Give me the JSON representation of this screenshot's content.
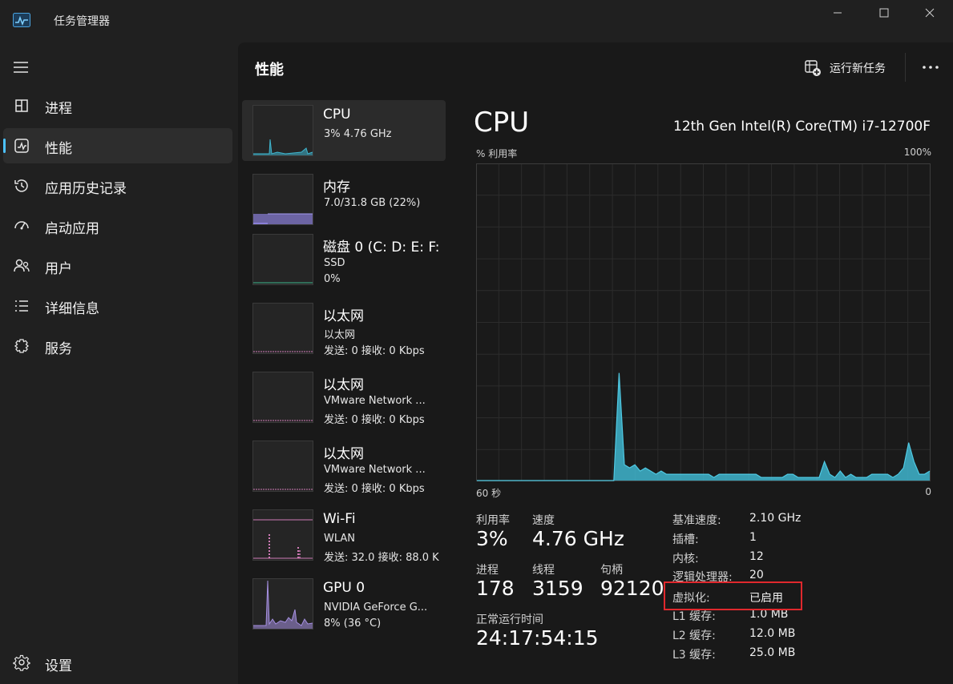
{
  "window": {
    "title": "任务管理器",
    "app_icon": "task-manager-icon",
    "controls": [
      "minimize-icon",
      "maximize-icon",
      "close-icon"
    ]
  },
  "sidebar": {
    "menu_icon": "hamburger-icon",
    "items": [
      {
        "label": "进程",
        "icon": "processes-icon"
      },
      {
        "label": "性能",
        "icon": "performance-icon",
        "active": true
      },
      {
        "label": "应用历史记录",
        "icon": "history-icon"
      },
      {
        "label": "启动应用",
        "icon": "startup-icon"
      },
      {
        "label": "用户",
        "icon": "users-icon"
      },
      {
        "label": "详细信息",
        "icon": "details-icon"
      },
      {
        "label": "服务",
        "icon": "services-icon"
      }
    ],
    "settings": {
      "label": "设置",
      "icon": "gear-icon"
    }
  },
  "header": {
    "title": "性能",
    "run_task_label": "运行新任务",
    "more_icon": "more-icon"
  },
  "devices": [
    {
      "name": "CPU",
      "line1": "3% 4.76 GHz",
      "line2": "",
      "color": "#3fb6cf",
      "active": true
    },
    {
      "name": "内存",
      "line1": "7.0/31.8 GB (22%)",
      "line2": "",
      "color": "#8a7fd8"
    },
    {
      "name": "磁盘 0 (C: D: E: F:",
      "line1": "SSD",
      "line2": "0%",
      "color": "#3bb58b"
    },
    {
      "name": "以太网",
      "line1": "以太网",
      "line2": "发送: 0 接收: 0 Kbps",
      "color": "#d07bb7"
    },
    {
      "name": "以太网",
      "line1": "VMware Network ...",
      "line2": "发送: 0 接收: 0 Kbps",
      "color": "#d07bb7"
    },
    {
      "name": "以太网",
      "line1": "VMware Network ...",
      "line2": "发送: 0 接收: 0 Kbps",
      "color": "#d07bb7"
    },
    {
      "name": "Wi-Fi",
      "line1": "WLAN",
      "line2": "发送: 32.0 接收: 88.0 K",
      "color": "#d07bb7"
    },
    {
      "name": "GPU 0",
      "line1": "NVIDIA GeForce G...",
      "line2": "8% (36 °C)",
      "color": "#a58fe0"
    }
  ],
  "cpu": {
    "title": "CPU",
    "model": "12th Gen Intel(R) Core(TM) i7-12700F",
    "graph_label_top_left": "% 利用率",
    "graph_label_top_right": "100%",
    "graph_label_bottom_left": "60 秒",
    "graph_label_bottom_right": "0",
    "graph_color": "#3fb6cf",
    "utilization_history": [
      0,
      0,
      0,
      0,
      0,
      0,
      0,
      0,
      0,
      0,
      0,
      0,
      0,
      0,
      0,
      0,
      0,
      0,
      0,
      0,
      0,
      0,
      0,
      0,
      0,
      0,
      0,
      34,
      5,
      4,
      5,
      3,
      4,
      3,
      2,
      3,
      2,
      2,
      2,
      2,
      2,
      2,
      2,
      2,
      2,
      1,
      2,
      2,
      2,
      2,
      2,
      2,
      2,
      2,
      1,
      1,
      1,
      1,
      1,
      2,
      2,
      1,
      1,
      1,
      1,
      1,
      6,
      2,
      1,
      3,
      1,
      2,
      1,
      1,
      1,
      2,
      2,
      2,
      2,
      1,
      2,
      4,
      12,
      6,
      2,
      2,
      3
    ],
    "stats": {
      "utilization_label": "利用率",
      "utilization_value": "3%",
      "speed_label": "速度",
      "speed_value": "4.76 GHz",
      "processes_label": "进程",
      "processes_value": "178",
      "threads_label": "线程",
      "threads_value": "3159",
      "handles_label": "句柄",
      "handles_value": "92120",
      "uptime_label": "正常运行时间",
      "uptime_value": "24:17:54:15"
    },
    "specs": [
      {
        "key": "基准速度:",
        "value": "2.10 GHz"
      },
      {
        "key": "插槽:",
        "value": "1"
      },
      {
        "key": "内核:",
        "value": "12"
      },
      {
        "key": "逻辑处理器:",
        "value": "20"
      },
      {
        "key": "虚拟化:",
        "value": "已启用"
      },
      {
        "key": "L1 缓存:",
        "value": "1.0 MB"
      },
      {
        "key": "L2 缓存:",
        "value": "12.0 MB"
      },
      {
        "key": "L3 缓存:",
        "value": "25.0 MB"
      }
    ],
    "highlight_color": "#e0282d"
  }
}
